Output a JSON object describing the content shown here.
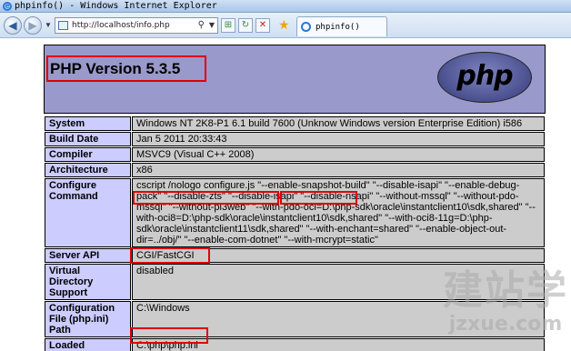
{
  "window": {
    "title": "phpinfo() - Windows Internet Explorer"
  },
  "toolbar": {
    "back_glyph": "◀",
    "forward_glyph": "▶",
    "url": "http://localhost/info.php",
    "compat_glyph": "⊞",
    "refresh_glyph": "↻",
    "stop_glyph": "✕",
    "favorites_glyph": "★",
    "tab_title": "phpinfo()"
  },
  "header": {
    "version": "PHP Version 5.3.5",
    "logo_text": "php"
  },
  "rows": [
    {
      "label": "System",
      "value": "Windows NT 2K8-P1 6.1 build 7600 (Unknow Windows version Enterprise Edition) i586"
    },
    {
      "label": "Build Date",
      "value": "Jan 5 2011 20:33:43"
    },
    {
      "label": "Compiler",
      "value": "MSVC9 (Visual C++ 2008)"
    },
    {
      "label": "Architecture",
      "value": "x86"
    },
    {
      "label": "Configure Command",
      "value": "cscript /nologo configure.js \"--enable-snapshot-build\" \"--disable-isapi\" \"--enable-debug-pack\" \"--disable-zts\" \"--disable-isapi\" \"--disable-nsapi\" \"--without-mssql\" \"--without-pdo-mssql\" \"--without-pi3web\" \"--with-pdo-oci=D:\\php-sdk\\oracle\\instantclient10\\sdk,shared\" \"--with-oci8=D:\\php-sdk\\oracle\\instantclient10\\sdk,shared\" \"--with-oci8-11g=D:\\php-sdk\\oracle\\instantclient11\\sdk,shared\" \"--with-enchant=shared\" \"--enable-object-out-dir=../obj/\" \"--enable-com-dotnet\" \"--with-mcrypt=static\""
    },
    {
      "label": "Server API",
      "value": "CGI/FastCGI"
    },
    {
      "label": "Virtual Directory Support",
      "value": "disabled"
    },
    {
      "label": "Configuration File (php.ini) Path",
      "value": "C:\\Windows"
    },
    {
      "label": "Loaded Configuration",
      "value": "C:\\php\\php.ini"
    }
  ],
  "watermark": {
    "cn": "建站学",
    "url": "jzxue.com"
  },
  "colors": {
    "header_bg": "#9999cc",
    "label_bg": "#ccccff",
    "value_bg": "#cccccc",
    "highlight": "#e00000"
  }
}
